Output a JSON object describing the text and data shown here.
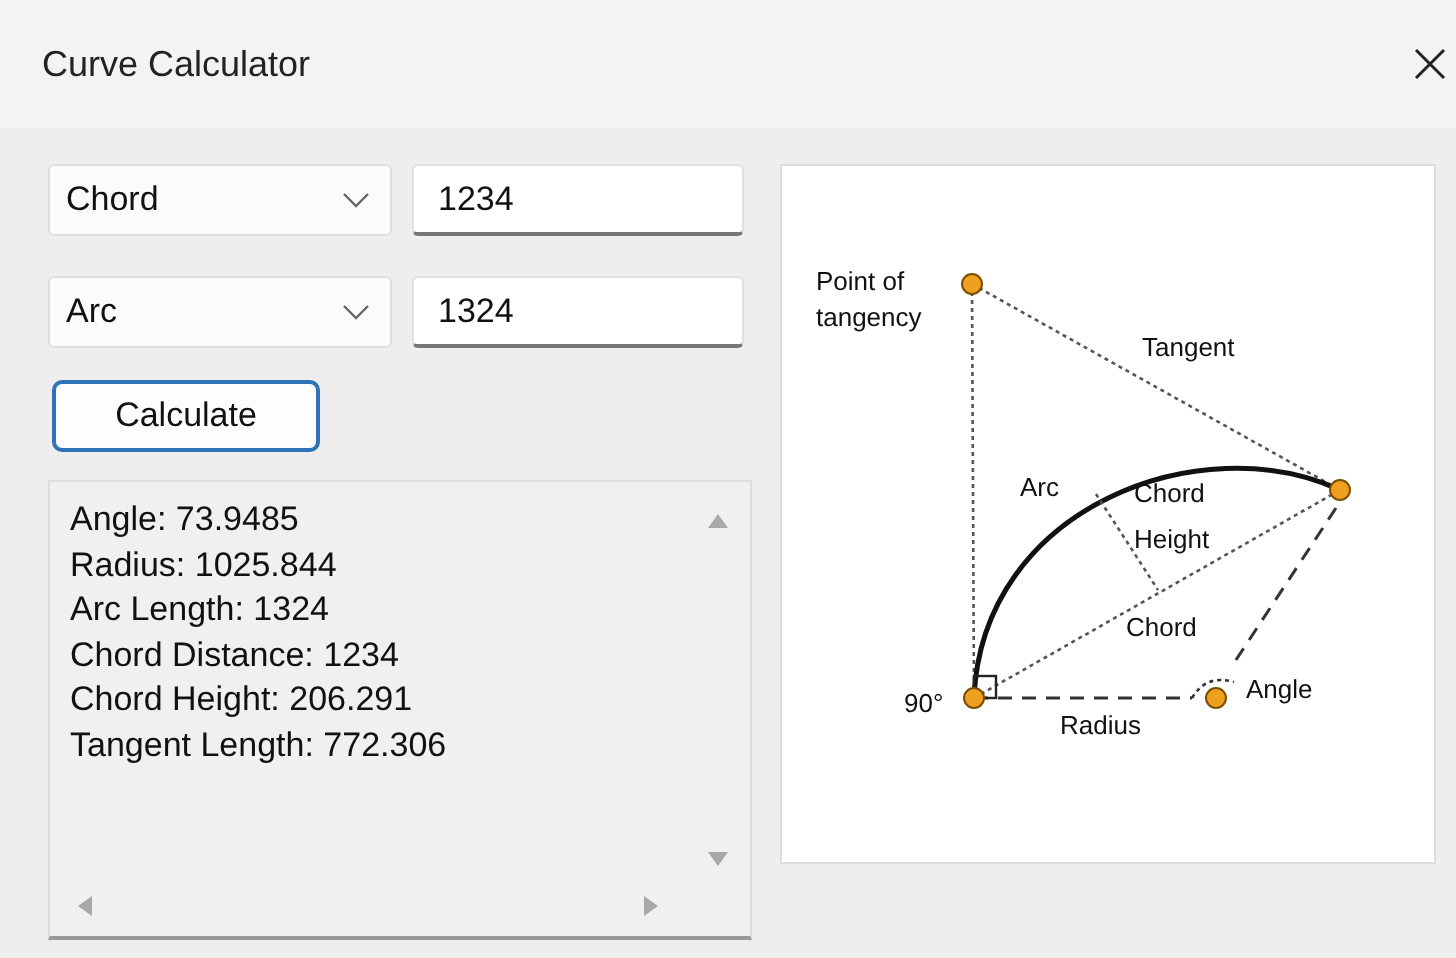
{
  "window": {
    "title": "Curve Calculator"
  },
  "inputs": [
    {
      "select": "Chord",
      "value": "1234"
    },
    {
      "select": "Arc",
      "value": "1324"
    }
  ],
  "calculate_button": "Calculate",
  "results": [
    "Angle: 73.9485",
    "Radius: 1025.844",
    "Arc Length: 1324",
    "Chord Distance: 1234",
    "Chord Height: 206.291",
    "Tangent Length: 772.306"
  ],
  "diagram": {
    "labels": [
      "Point of",
      "tangency",
      "Tangent",
      "Arc",
      "Chord",
      "Height",
      "Chord",
      "90°",
      "Radius",
      "Angle"
    ]
  }
}
